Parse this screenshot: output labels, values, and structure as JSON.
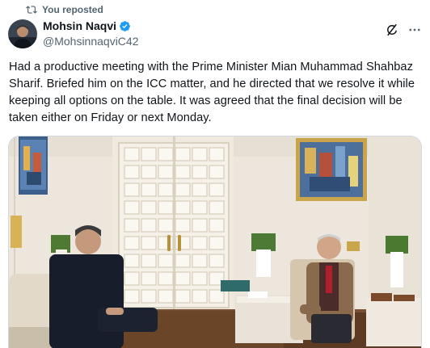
{
  "repost": {
    "label": "You reposted",
    "icon": "repost-icon"
  },
  "author": {
    "name": "Mohsin Naqvi",
    "handle": "@MohsinnaqviC42",
    "verified_color": "#1d9bf0",
    "avatar_icon": "avatar"
  },
  "actions": {
    "grok_icon": "grok-icon",
    "more_icon": "more-icon"
  },
  "tweet": {
    "text": "Had a productive meeting with the Prime Minister Mian Muhammad Shahbaz Sharif. Briefed him on the ICC matter, and he directed that we resolve it while keeping all options on the table. It was agreed that the final decision will be taken either on Friday or next Monday."
  },
  "media": {
    "type": "photo"
  },
  "colors": {
    "secondary_text": "#536471",
    "primary_text": "#0f1419",
    "border": "#cfd9de"
  }
}
